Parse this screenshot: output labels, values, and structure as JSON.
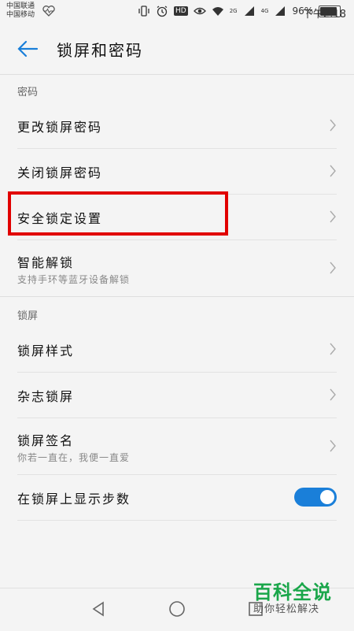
{
  "status": {
    "carrier_line1": "中国联通",
    "carrier_line2": "中国移动",
    "network_left": "2G",
    "network_right": "4G",
    "battery_pct": "96%",
    "battery_level": 0.96,
    "time": "下午2:18",
    "hd_label": "HD"
  },
  "appbar": {
    "title": "锁屏和密码"
  },
  "sections": {
    "password": {
      "header": "密码",
      "items": [
        {
          "label": "更改锁屏密码"
        },
        {
          "label": "关闭锁屏密码"
        },
        {
          "label": "安全锁定设置"
        },
        {
          "label": "智能解锁",
          "sub": "支持手环等蓝牙设备解锁"
        }
      ]
    },
    "lockscreen": {
      "header": "锁屏",
      "items": [
        {
          "label": "锁屏样式"
        },
        {
          "label": "杂志锁屏"
        },
        {
          "label": "锁屏签名",
          "sub": "你若一直在，我便一直爱"
        },
        {
          "label": "在锁屏上显示步数",
          "toggle_on": true
        }
      ]
    }
  },
  "colors": {
    "accent": "#1a7fd9",
    "highlight": "#e10000",
    "watermark": "#1aa64a"
  },
  "watermark": {
    "main": "百科全说",
    "sub": "助你轻松解决"
  }
}
